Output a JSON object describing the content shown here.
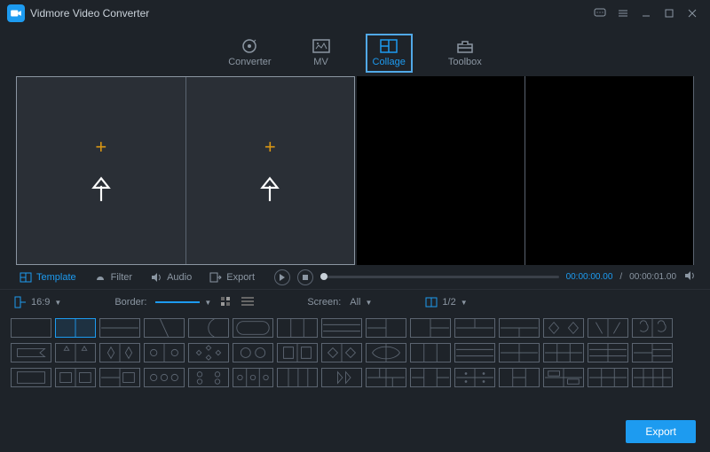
{
  "app": {
    "title": "Vidmore Video Converter"
  },
  "main_tabs": {
    "converter": "Converter",
    "mv": "MV",
    "collage": "Collage",
    "toolbox": "Toolbox"
  },
  "subtabs": {
    "template": "Template",
    "filter": "Filter",
    "audio": "Audio",
    "export": "Export"
  },
  "playback": {
    "current": "00:00:00.00",
    "total": "00:00:01.00"
  },
  "options": {
    "ratio_label": "16:9",
    "border_label": "Border:",
    "screen_label": "Screen:",
    "screen_value": "All",
    "pager": "1/2"
  },
  "footer": {
    "export": "Export"
  }
}
